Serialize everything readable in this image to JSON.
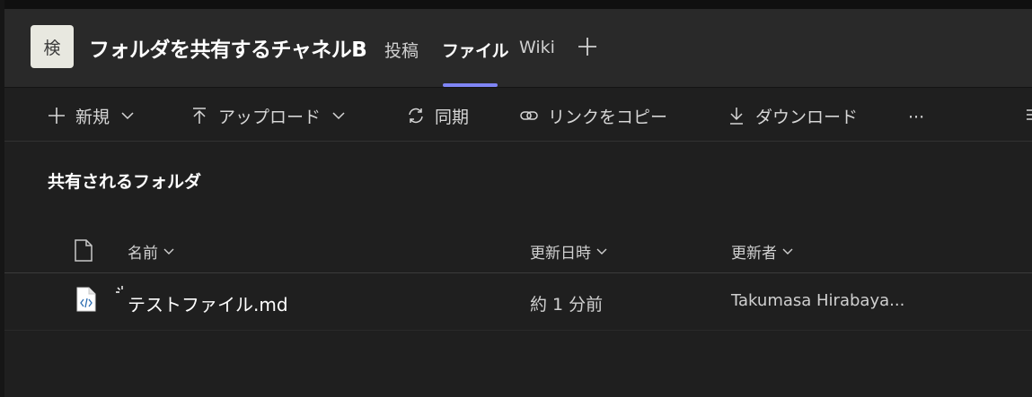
{
  "header": {
    "avatar_text": "検",
    "channel_title": "フォルダを共有するチャネルB",
    "tabs": [
      {
        "label": "投稿",
        "active": false
      },
      {
        "label": "ファイル",
        "active": true
      },
      {
        "label": "Wiki",
        "active": false
      }
    ],
    "add_tab_icon": "plus-icon",
    "accent_color": "#7f85f5"
  },
  "toolbar": {
    "new_label": "新規",
    "upload_label": "アップロード",
    "sync_label": "同期",
    "copy_link_label": "リンクをコピー",
    "download_label": "ダウンロード",
    "more_label": "···"
  },
  "content": {
    "section_title": "共有されるフォルダ",
    "columns": {
      "name": "名前",
      "modified": "更新日時",
      "modified_by": "更新者"
    },
    "files": [
      {
        "name": "テストファイル.md",
        "modified": "約 1 分前",
        "modified_by": "Takumasa Hirabaya...",
        "icon": "code-file-icon"
      }
    ]
  },
  "colors": {
    "background": "#1f1f1f",
    "header_background": "#292929",
    "text_primary": "#ffffff",
    "text_secondary": "#d0d0d0"
  }
}
